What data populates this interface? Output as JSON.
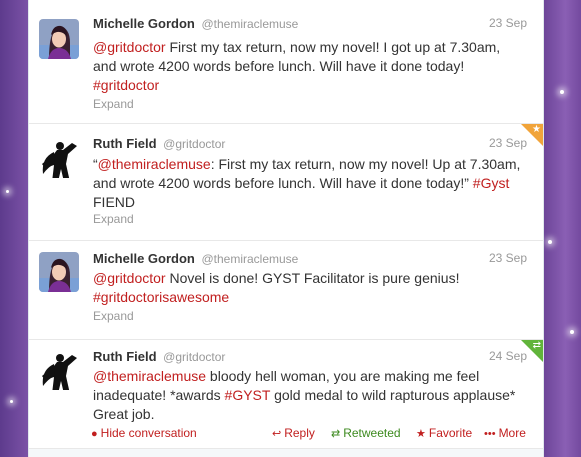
{
  "tweets": [
    {
      "name": "Michelle Gordon",
      "handle": "@themiraclemuse",
      "time": "23 Sep",
      "text_parts": [
        {
          "text": "@gritdoctor",
          "link": true
        },
        {
          "text": " First my tax return, now my novel! I got up at 7.30am, and wrote 4200 words before lunch. Will have it done today! ",
          "link": false
        },
        {
          "text": "#gritdoctor",
          "link": true
        }
      ],
      "expand": "Expand"
    },
    {
      "name": "Ruth Field",
      "handle": "@gritdoctor",
      "time": "23 Sep",
      "text_parts": [
        {
          "text": "“",
          "link": false
        },
        {
          "text": "@themiraclemuse",
          "link": true
        },
        {
          "text": ": First my tax return, now my novel! Up at 7.30am, and wrote 4200 words before lunch. Will have it done today!” ",
          "link": false
        },
        {
          "text": "#Gyst",
          "link": true
        },
        {
          "text": " FIEND",
          "link": false
        }
      ],
      "expand": "Expand",
      "corner": "star",
      "corner_glyph": "★"
    },
    {
      "name": "Michelle Gordon",
      "handle": "@themiraclemuse",
      "time": "23 Sep",
      "text_parts": [
        {
          "text": "@gritdoctor",
          "link": true
        },
        {
          "text": " Novel is done! GYST Facilitator is pure genius! ",
          "link": false
        },
        {
          "text": "#gritdoctorisawesome",
          "link": true
        }
      ],
      "expand": "Expand"
    },
    {
      "name": "Ruth Field",
      "handle": "@gritdoctor",
      "time": "24 Sep",
      "text_parts": [
        {
          "text": "@themiraclemuse",
          "link": true
        },
        {
          "text": " bloody hell woman, you are making me feel inadequate! *awards ",
          "link": false
        },
        {
          "text": "#GYST",
          "link": true
        },
        {
          "text": " gold medal to wild rapturous applause* Great job.",
          "link": false
        }
      ],
      "corner": "retweet",
      "corner_glyph": "⇄",
      "actions": {
        "hide": "Hide conversation",
        "reply": "Reply",
        "retweeted": "Retweeted",
        "favorite": "Favorite",
        "more": "More"
      }
    }
  ],
  "colors": {
    "link": "#c11f1f",
    "retweeted": "#3d8a1f",
    "star_corner": "#f1a43a",
    "retweet_corner": "#61b43a",
    "background": "#7d56a8"
  }
}
